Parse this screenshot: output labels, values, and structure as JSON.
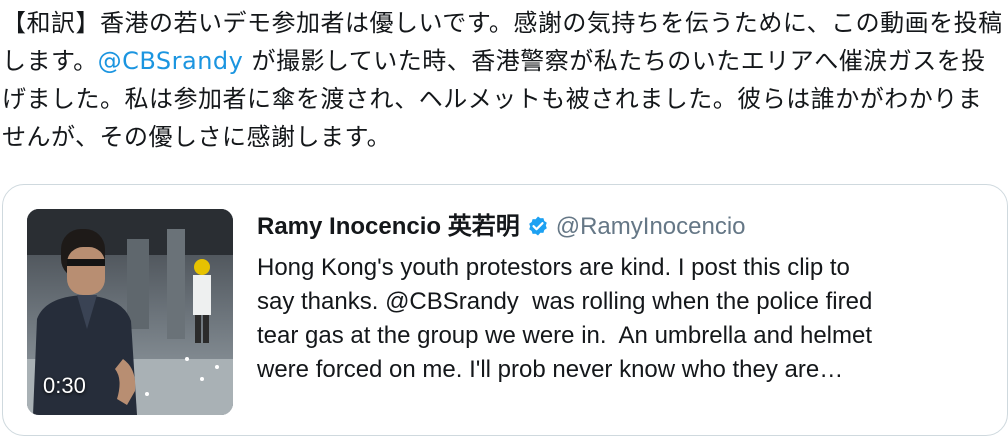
{
  "tweet": {
    "text_parts": [
      "【和訳】香港の若いデモ参加者は優しいです。感謝の気持ちを伝うために、この動画を投稿します。",
      "@CBSrandy",
      " が撮影していた時、香港警察が私たちのいたエリアへ催涙ガスを投げました。私は参加者に傘を渡され、ヘルメットも被されました。彼らは誰かがわかりませんが、その優しさに感謝します。"
    ]
  },
  "quote": {
    "display_name": "Ramy Inocencio 英若明",
    "handle": "@RamyInocencio",
    "verified": true,
    "video_duration": "0:30",
    "text_lines": [
      "Hong Kong's youth protestors are kind. I post this clip to",
      "say thanks. @CBSrandy  was rolling when the police fired",
      "tear gas at the group we were in.  An umbrella and helmet",
      "were forced on me. I'll prob never know who they are…"
    ]
  },
  "colors": {
    "link": "#1b95e0",
    "verified_badge": "#1da1f2",
    "handle_gray": "#657786",
    "card_border": "#cfd9de"
  }
}
